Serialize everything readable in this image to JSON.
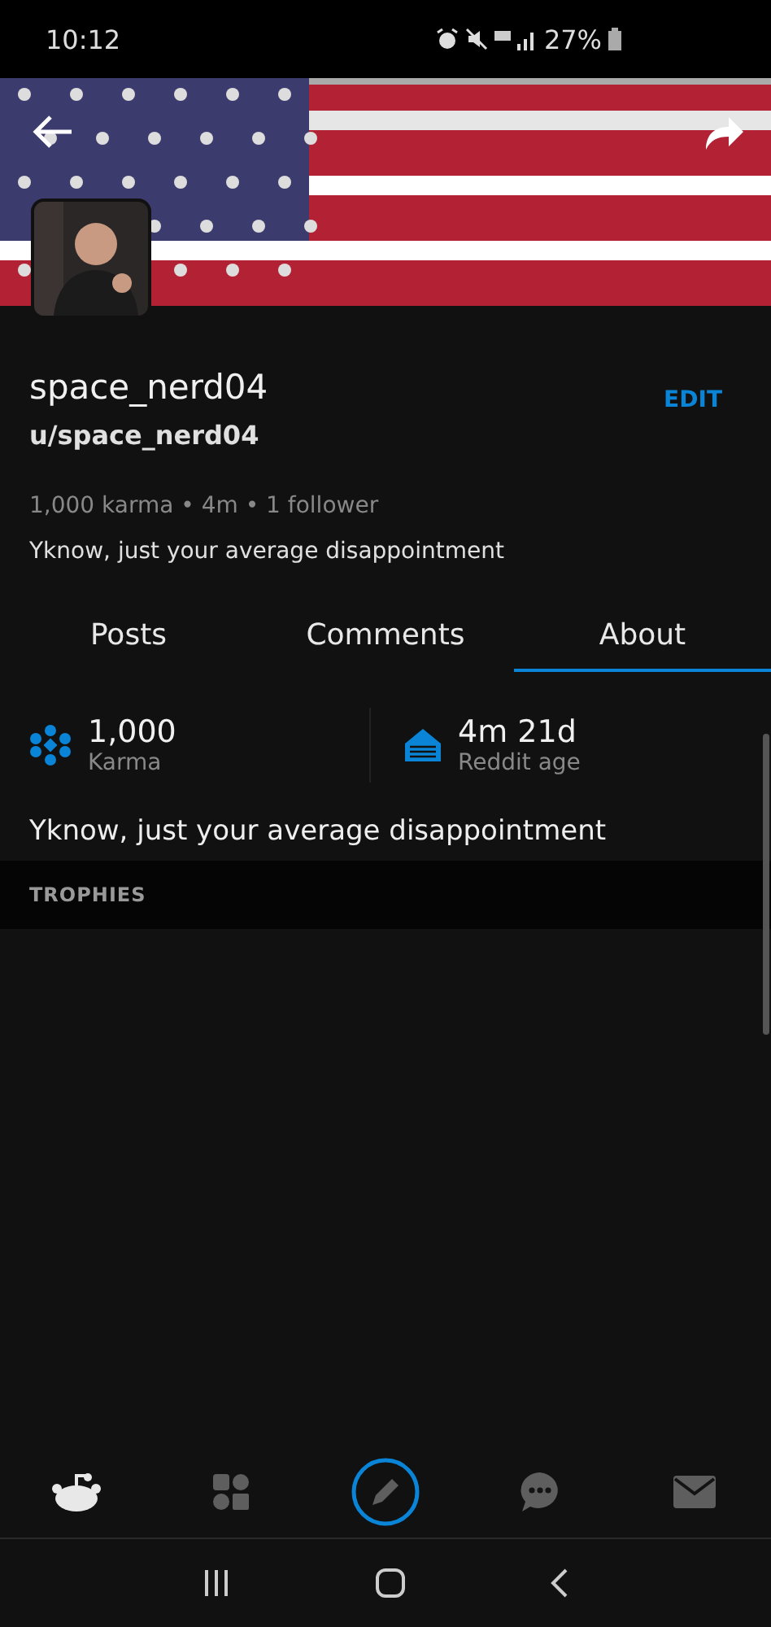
{
  "status_bar": {
    "time": "10:12",
    "battery": "27%"
  },
  "profile": {
    "display_name": "space_nerd04",
    "username": "u/space_nerd04",
    "edit": "EDIT",
    "meta": "1,000 karma • 4m • 1 follower",
    "bio": "Yknow, just your average disappointment"
  },
  "tabs": [
    {
      "label": "Posts",
      "selected": false
    },
    {
      "label": "Comments",
      "selected": false
    },
    {
      "label": "About",
      "selected": true
    }
  ],
  "stats": [
    {
      "kind": "karma",
      "value": "1,000",
      "label": "Karma"
    },
    {
      "kind": "age",
      "value": "4m 21d",
      "label": "Reddit age"
    }
  ],
  "about": {
    "description": "Yknow, just your average disappointment",
    "section": "TROPHIES"
  },
  "bottom_nav": [
    {
      "kind": "home",
      "selected": true
    },
    {
      "kind": "communities",
      "selected": false
    },
    {
      "kind": "create",
      "selected": false
    },
    {
      "kind": "chat",
      "selected": false
    },
    {
      "kind": "inbox",
      "selected": false
    }
  ]
}
